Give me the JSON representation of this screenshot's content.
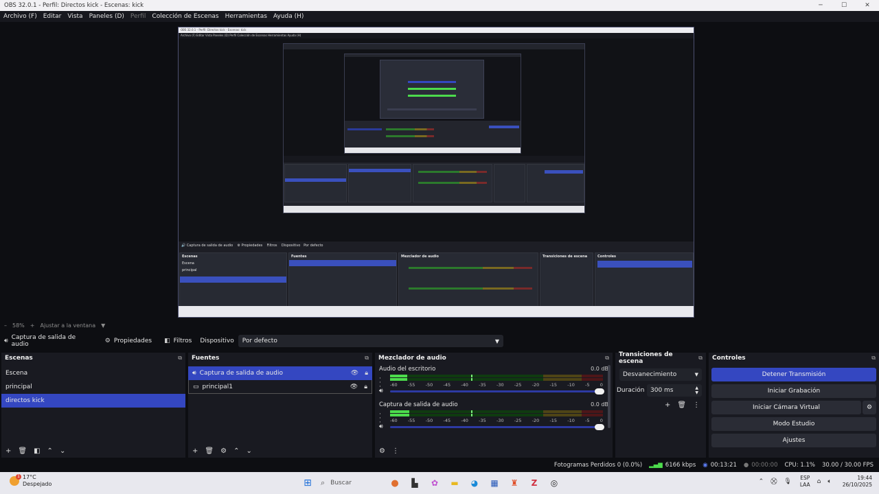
{
  "window": {
    "title": "OBS 32.0.1 - Perfil: Directos kick - Escenas: kick",
    "minimize": "─",
    "maximize": "☐",
    "close": "✕"
  },
  "menu": {
    "archivo": "Archivo (F)",
    "editar": "Editar",
    "vista": "Vista",
    "paneles": "Paneles (D)",
    "perfil": "Perfil",
    "coleccion": "Colección de Escenas",
    "herramientas": "Herramientas",
    "ayuda": "Ayuda (H)"
  },
  "zoom": {
    "minus": "–",
    "value": "58%",
    "plus": "+",
    "fit": "Ajustar a la ventana",
    "caret": "▼"
  },
  "source_toolbar": {
    "source_name": "Captura de salida de audio",
    "properties": "Propiedades",
    "filters": "Filtros",
    "device_label": "Dispositivo",
    "device_value": "Por defecto"
  },
  "scenes": {
    "title": "Escenas",
    "items": [
      "Escena",
      "principal",
      "directos kick"
    ],
    "selected_index": 2
  },
  "sources": {
    "title": "Fuentes",
    "items": [
      "Captura de salida de audio",
      "principal1"
    ],
    "selected_index": 0
  },
  "mixer": {
    "title": "Mezclador de audio",
    "channels": [
      {
        "name": "Audio del escritorio",
        "db": "0.0 dB",
        "level": 0.08,
        "peak": 0.38
      },
      {
        "name": "Captura de salida de audio",
        "db": "0.0 dB",
        "level": 0.09,
        "peak": 0.38
      }
    ],
    "ticks": [
      "-60",
      "-55",
      "-50",
      "-45",
      "-40",
      "-35",
      "-30",
      "-25",
      "-20",
      "-15",
      "-10",
      "-5",
      "0"
    ]
  },
  "transitions": {
    "title": "Transiciones de escena",
    "type": "Desvanecimiento",
    "duration_label": "Duración",
    "duration_value": "300 ms"
  },
  "controls": {
    "title": "Controles",
    "stop_stream": "Detener Transmisión",
    "start_recording": "Iniciar Grabación",
    "start_virtual_cam": "Iniciar Cámara Virtual",
    "studio_mode": "Modo Estudio",
    "settings": "Ajustes"
  },
  "status": {
    "dropped_frames": "Fotogramas Perdidos 0 (0.0%)",
    "bitrate": "6166 kbps",
    "stream_time": "00:13:21",
    "record_time": "00:00:00",
    "cpu": "CPU: 1.1%",
    "fps": "30.00 / 30.00 FPS"
  },
  "taskbar": {
    "weather_temp": "17°C",
    "weather_desc": "Despejado",
    "weather_badge": "1",
    "search": "Buscar",
    "lang_top": "ESP",
    "lang_bottom": "LAA",
    "time": "19:44",
    "date": "26/10/2025"
  },
  "nested_preview": {
    "title": "OBS 32.0.1 - Perfil: Directos kick - Escenas: kick",
    "menu": "Archivo (F)   Editar   Vista   Paneles (D)   Perfil   Colección de Escenas   Herramientas   Ayuda (H)"
  },
  "colors": {
    "accent": "#3447c1",
    "panel": "#191a21",
    "background": "#0d0e12",
    "meter_green": "#4cdc4c"
  }
}
